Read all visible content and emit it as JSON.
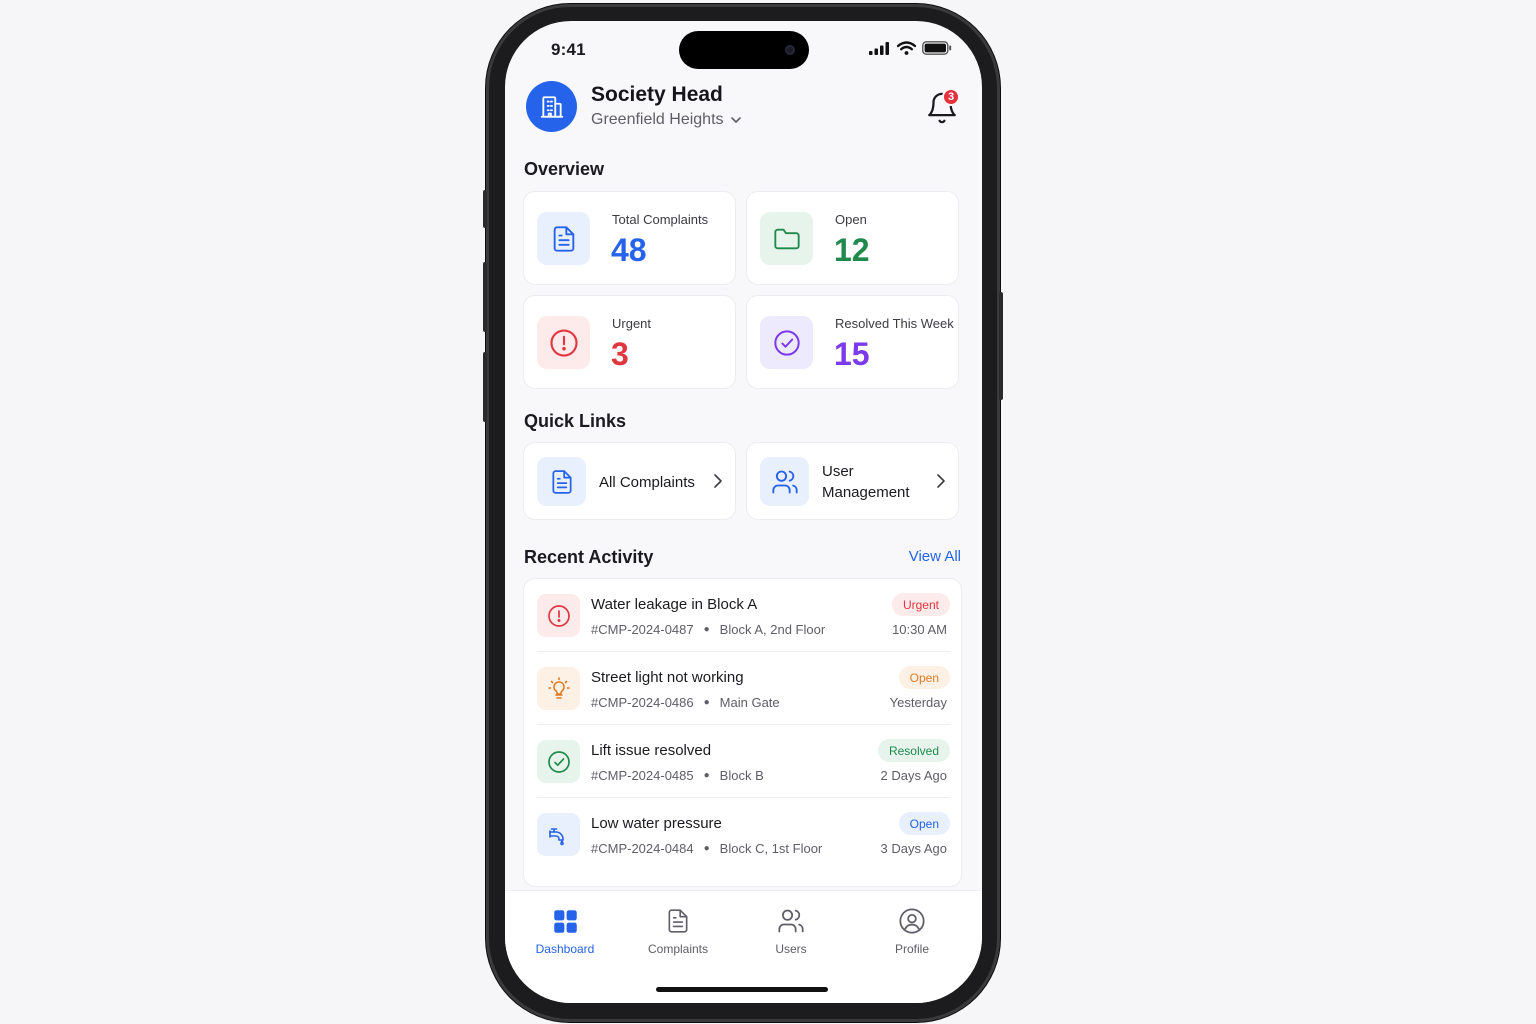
{
  "status_bar": {
    "time": "9:41",
    "icons": [
      "signal-icon",
      "wifi-icon",
      "battery-icon"
    ]
  },
  "header": {
    "title": "Society Head",
    "society": "Greenfield Heights",
    "notifications_count": "3",
    "avatar_icon": "building-icon"
  },
  "overview": {
    "title": "Overview",
    "cards": [
      {
        "label": "Total Complaints",
        "value": "48",
        "color": "#2563eb",
        "icon": "document-icon"
      },
      {
        "label": "Open",
        "value": "12",
        "color": "#1f8a4c",
        "icon": "folder-icon"
      },
      {
        "label": "Urgent",
        "value": "3",
        "color": "#e03640",
        "icon": "alert-circle-icon"
      },
      {
        "label": "Resolved This Week",
        "value": "15",
        "color": "#7c3aed",
        "icon": "check-circle-icon"
      }
    ]
  },
  "quick_links": {
    "title": "Quick Links",
    "items": [
      {
        "label": "All Complaints",
        "icon": "document-icon"
      },
      {
        "label_line1": "User",
        "label_line2": "Management",
        "icon": "users-icon"
      }
    ]
  },
  "recent_activity": {
    "title": "Recent Activity",
    "view_all": "View All",
    "items": [
      {
        "title": "Water leakage in Block A",
        "id": "#CMP-2024-0487",
        "location": "Block A, 2nd Floor",
        "status": "Urgent",
        "time": "10:30 AM",
        "icon": "alert-circle-icon"
      },
      {
        "title": "Street light not working",
        "id": "#CMP-2024-0486",
        "location": "Main Gate",
        "status": "Open",
        "time": "Yesterday",
        "icon": "lightbulb-icon"
      },
      {
        "title": "Lift issue resolved",
        "id": "#CMP-2024-0485",
        "location": "Block B",
        "status": "Resolved",
        "time": "2 Days Ago",
        "icon": "check-circle-icon"
      },
      {
        "title": "Low water pressure",
        "id": "#CMP-2024-0484",
        "location": "Block C, 1st Floor",
        "status": "Open",
        "time": "3 Days Ago",
        "icon": "faucet-icon"
      }
    ]
  },
  "tab_bar": {
    "tabs": [
      {
        "label": "Dashboard",
        "icon": "grid-icon",
        "active": true
      },
      {
        "label": "Complaints",
        "icon": "document-icon",
        "active": false
      },
      {
        "label": "Users",
        "icon": "users-icon",
        "active": false
      },
      {
        "label": "Profile",
        "icon": "user-circle-icon",
        "active": false
      }
    ]
  },
  "colors": {
    "accent": "#2563eb",
    "urgent": "#e03640",
    "open_orange": "#e07a24",
    "resolved_green": "#1f8a4c",
    "purple": "#7c3aed"
  }
}
